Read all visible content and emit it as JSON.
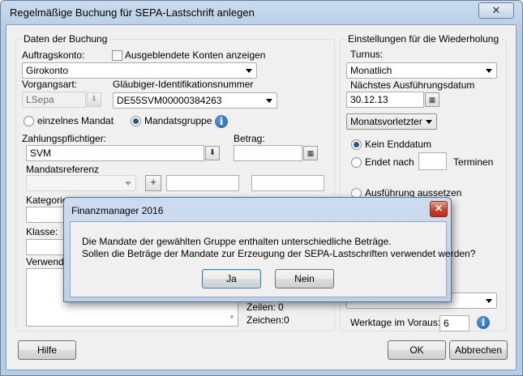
{
  "window": {
    "title": "Regelmäßige Buchung für SEPA-Lastschrift anlegen",
    "close": "✕"
  },
  "booking": {
    "legend": "Daten der Buchung",
    "account_label": "Auftragskonto:",
    "hidden_accounts_label": "Ausgeblendete Konten anzeigen",
    "account_value": "Girokonto",
    "process_label": "Vorgangsart:",
    "process_value": "LSepa",
    "creditor_label": "Gläubiger-Identifikationsnummer",
    "creditor_value": "DE55SVM00000384263",
    "single_mandate_label": "einzelnes Mandat",
    "mandate_group_label": "Mandatsgruppe",
    "payer_label": "Zahlungspflichtiger:",
    "payer_value": "SVM",
    "amount_label": "Betrag:",
    "amount_value": "",
    "mandate_ref_label": "Mandatsreferenz",
    "category_label": "Kategorie",
    "class_label": "Klasse:",
    "purpose_label": "Verwendu",
    "lines_label": "Zeilen:",
    "lines_value": "0",
    "chars_label": "Zeichen:",
    "chars_value": "0"
  },
  "repeat": {
    "legend": "Einstellungen für die Wiederholung",
    "interval_label": "Turnus:",
    "interval_value": "Monatlich",
    "next_date_label": "Nächstes Ausführungsdatum",
    "next_date_value": "30.12.13",
    "day_rule_value": "Monatsvorletzter",
    "no_end_label": "Kein Enddatum",
    "ends_after_label": "Endet nach",
    "ends_after_value": "",
    "terms_label": "Terminen",
    "suspend_label": "Ausführung aussetzen",
    "workdays_label": "Werktage im Voraus:",
    "workdays_value": "6"
  },
  "buttons": {
    "help": "Hilfe",
    "ok": "OK",
    "cancel": "Abbrechen"
  },
  "dialog": {
    "title": "Finanzmanager 2016",
    "close": "✕",
    "line1": "Die Mandate der gewählten Gruppe enthalten unterschiedliche Beträge.",
    "line2": "Sollen die Beträge der Mandate zur Erzeugung der SEPA-Lastschriften verwendet werden?",
    "yes": "Ja",
    "no": "Nein"
  }
}
